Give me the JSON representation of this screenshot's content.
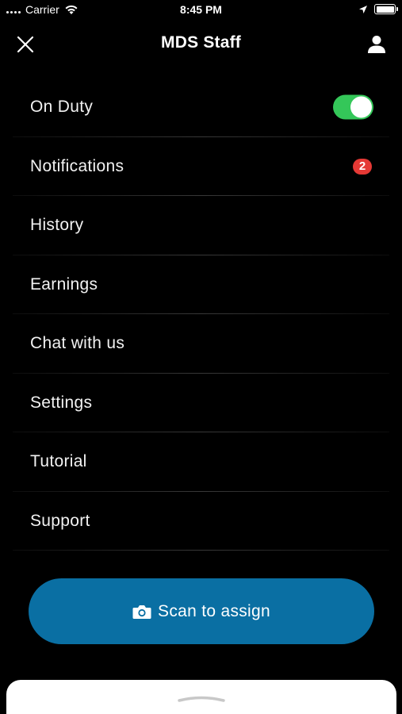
{
  "status_bar": {
    "carrier": "Carrier",
    "time": "8:45 PM"
  },
  "header": {
    "title": "MDS Staff",
    "close_icon": "close-icon",
    "profile_icon": "person-icon"
  },
  "menu": {
    "items": [
      {
        "label": "On Duty",
        "toggle_on": true
      },
      {
        "label": "Notifications",
        "badge": "2"
      },
      {
        "label": "History"
      },
      {
        "label": "Earnings"
      },
      {
        "label": "Chat with us"
      },
      {
        "label": "Settings"
      },
      {
        "label": "Tutorial"
      },
      {
        "label": "Support"
      }
    ]
  },
  "scan_button": {
    "label": "Scan to assign",
    "icon": "camera-icon"
  },
  "colors": {
    "background": "#000000",
    "toggle_on": "#34c759",
    "badge": "#e53935",
    "scan_button": "#0a6fa3"
  }
}
